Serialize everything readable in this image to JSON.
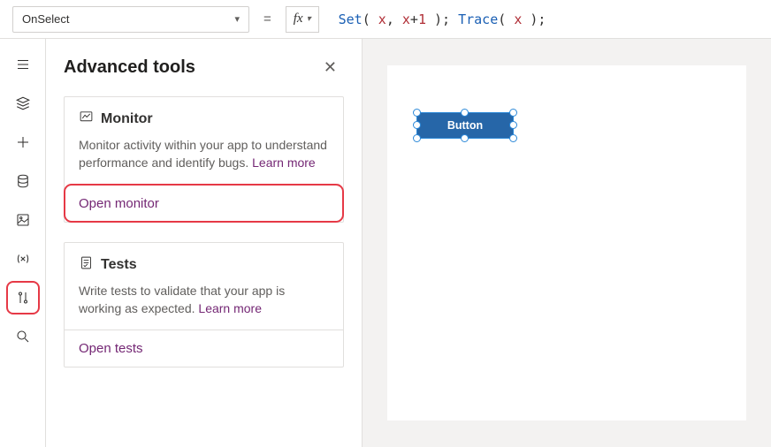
{
  "formula_bar": {
    "property": "OnSelect",
    "fx_label": "fx",
    "formula_tokens": [
      {
        "t": "Set",
        "c": "blue"
      },
      {
        "t": "( ",
        "c": ""
      },
      {
        "t": "x",
        "c": "red"
      },
      {
        "t": ", ",
        "c": ""
      },
      {
        "t": "x",
        "c": "red"
      },
      {
        "t": "+",
        "c": ""
      },
      {
        "t": "1",
        "c": "red"
      },
      {
        "t": " ); ",
        "c": ""
      },
      {
        "t": "Trace",
        "c": "blue"
      },
      {
        "t": "( ",
        "c": ""
      },
      {
        "t": "x",
        "c": "red"
      },
      {
        "t": " );",
        "c": ""
      }
    ]
  },
  "rail_items": [
    {
      "name": "hamburger-icon"
    },
    {
      "name": "tree-view-icon"
    },
    {
      "name": "insert-icon"
    },
    {
      "name": "data-icon"
    },
    {
      "name": "media-icon"
    },
    {
      "name": "variables-icon"
    },
    {
      "name": "advanced-tools-icon",
      "highlighted": true
    },
    {
      "name": "search-icon"
    }
  ],
  "panel": {
    "title": "Advanced tools",
    "cards": [
      {
        "icon": "monitor-icon",
        "title": "Monitor",
        "desc": "Monitor activity within your app to understand performance and identify bugs. ",
        "learn_more": "Learn more",
        "action": "Open monitor",
        "action_highlighted": true
      },
      {
        "icon": "tests-icon",
        "title": "Tests",
        "desc": "Write tests to validate that your app is working as expected. ",
        "learn_more": "Learn more",
        "action": "Open tests",
        "action_highlighted": false
      }
    ]
  },
  "canvas": {
    "button_label": "Button"
  }
}
